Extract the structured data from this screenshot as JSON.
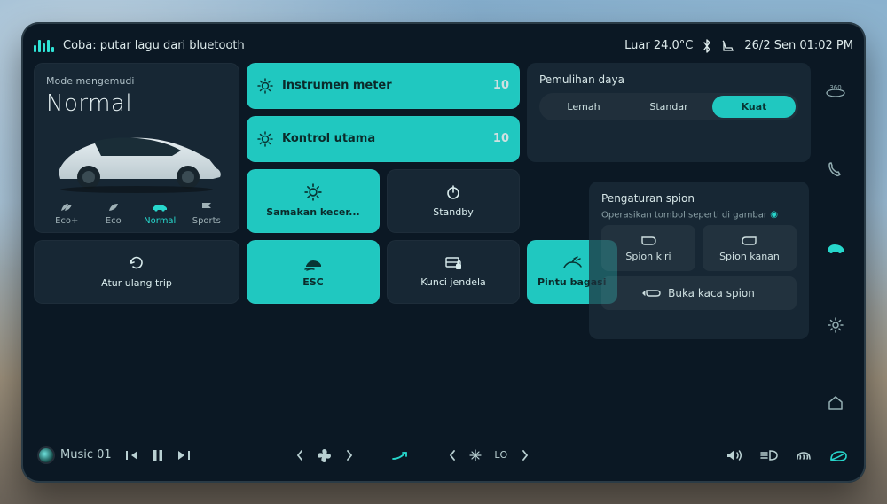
{
  "colors": {
    "accent": "#20c8c0",
    "bg": "#0b1824"
  },
  "topbar": {
    "voice_hint": "Coba: putar lagu dari bluetooth",
    "outside_temp": "Luar 24.0°C",
    "date_time": "26/2 Sen 01:02 PM"
  },
  "drive": {
    "label": "Mode mengemudi",
    "current": "Normal",
    "modes": [
      {
        "id": "ecoplus",
        "label": "Eco+"
      },
      {
        "id": "eco",
        "label": "Eco"
      },
      {
        "id": "normal",
        "label": "Normal",
        "active": true
      },
      {
        "id": "sports",
        "label": "Sports"
      }
    ]
  },
  "gauges": {
    "instrument": {
      "label": "Instrumen meter",
      "value": "10"
    },
    "main": {
      "label": "Kontrol utama",
      "value": "10"
    }
  },
  "actions": {
    "sync_speed": "Samakan kecer...",
    "standby": "Standby",
    "reset_trip": "Atur ulang trip",
    "esc": "ESC",
    "window_lock": "Kunci jendela",
    "trunk": "Pintu bagasi"
  },
  "power_recovery": {
    "title": "Pemulihan daya",
    "options": [
      "Lemah",
      "Standar",
      "Kuat"
    ],
    "active": 2
  },
  "mirror": {
    "title": "Pengaturan spion",
    "subtitle": "Operasikan tombol seperti di gambar",
    "left": "Spion kiri",
    "right": "Spion kanan",
    "wide": "Buka kaca spion"
  },
  "sidebar": {
    "items": [
      "360view",
      "phone",
      "car-settings",
      "settings",
      "home"
    ],
    "active": "car-settings"
  },
  "bottombar": {
    "track": "Music 01",
    "climate_temp": "LO"
  }
}
